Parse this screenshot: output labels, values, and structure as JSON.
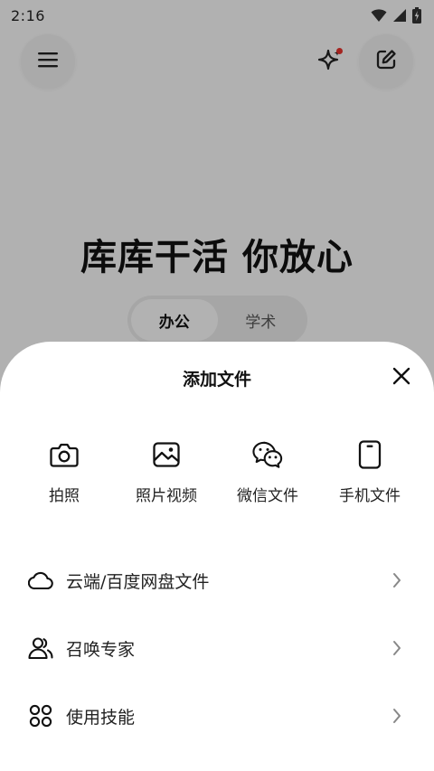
{
  "status_bar": {
    "time": "2:16",
    "icons": [
      "wifi-icon",
      "cellular-signal-icon",
      "battery-charging-icon"
    ]
  },
  "header": {
    "menu_icon": "hamburger-menu-icon",
    "sparkle_icon": "sparkle-icon",
    "edit_icon": "edit-note-icon",
    "notification_dot_color": "#e4332d"
  },
  "hero": {
    "title": "库库干活 你放心"
  },
  "mode_switch": {
    "tabs": [
      {
        "label": "办公",
        "active": true
      },
      {
        "label": "学术",
        "active": false
      }
    ]
  },
  "sheet": {
    "title": "添加文件",
    "close_icon": "close-icon",
    "actions": [
      {
        "label": "拍照",
        "icon": "camera-icon"
      },
      {
        "label": "照片视频",
        "icon": "image-icon"
      },
      {
        "label": "微信文件",
        "icon": "wechat-icon"
      },
      {
        "label": "手机文件",
        "icon": "phone-icon"
      }
    ],
    "list": [
      {
        "label": "云端/百度网盘文件",
        "icon": "cloud-icon"
      },
      {
        "label": "召唤专家",
        "icon": "users-icon"
      },
      {
        "label": "使用技能",
        "icon": "grid-circles-icon"
      }
    ]
  },
  "colors": {
    "sheet_bg": "#ffffff",
    "scrim": "rgba(0,0,0,0.28)",
    "text_primary": "#111111",
    "accent_red": "#e4332d"
  }
}
